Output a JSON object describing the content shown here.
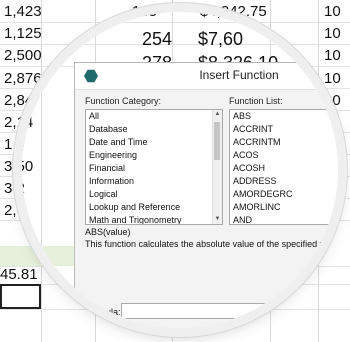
{
  "sheet": {
    "col1": [
      "1,423",
      "1,125",
      "2,500",
      "2,876",
      "2,84",
      "2,14",
      "1,9",
      "3,50",
      "3,2",
      "2,6"
    ],
    "col2": [
      "145",
      "254",
      "278"
    ],
    "col3": [
      "$4,342.75",
      "$7,60",
      "$8,326.10"
    ],
    "col4": [
      "10",
      "10",
      "10",
      "10",
      "10",
      "10",
      "10",
      "10",
      "10",
      "10"
    ],
    "total": "45.81"
  },
  "dialog": {
    "title": "Insert Function",
    "category_label": "Function Category:",
    "list_label": "Function List:",
    "categories": [
      "All",
      "Database",
      "Date and Time",
      "Engineering",
      "Financial",
      "Information",
      "Logical",
      "Lookup and Reference",
      "Math and Trigonometry"
    ],
    "functions": [
      "ABS",
      "ACCRINT",
      "ACCRINTM",
      "ACOS",
      "ACOSH",
      "ADDRESS",
      "AMORDEGRC",
      "AMORLINC",
      "AND"
    ],
    "signature": "ABS(value)",
    "description": "This function calculates the absolute value of the specified value.",
    "formula_label": "Formula:",
    "formula_value": ""
  },
  "colors": {
    "app_icon": "#1f6b6b",
    "selected_band": "#e6f0da"
  },
  "icons": {
    "app": "hexagon-app-icon",
    "scroll_up": "arrow-up-icon",
    "scroll_down": "arrow-down-icon"
  }
}
